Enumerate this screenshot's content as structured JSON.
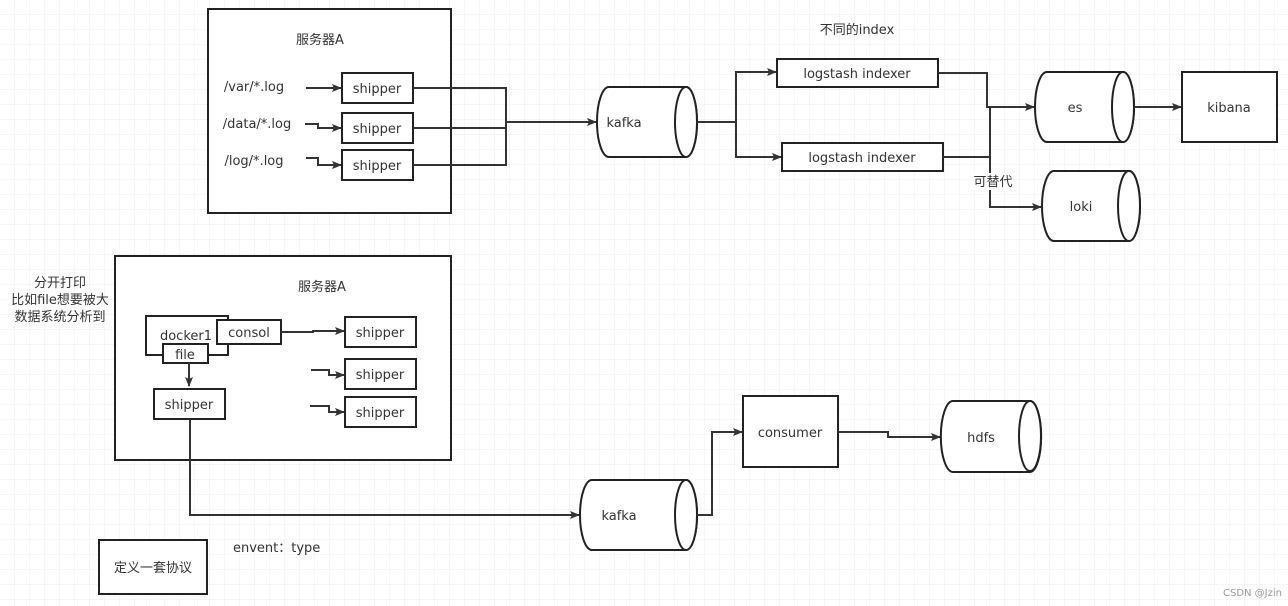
{
  "top": {
    "server_title": "服务器A",
    "log_paths": [
      "/var/*.log",
      "/data/*.log",
      "/log/*.log"
    ],
    "shippers": [
      "shipper",
      "shipper",
      "shipper"
    ],
    "kafka": "kafka",
    "index_note": "不同的index",
    "indexers": [
      "logstash indexer",
      "logstash indexer"
    ],
    "es": "es",
    "kibana": "kibana",
    "alt_label": "可替代",
    "loki": "loki"
  },
  "bottom": {
    "note_lines": [
      "分开打印",
      "比如file想要被大",
      "数据系统分析到"
    ],
    "server_title": "服务器A",
    "docker": "docker1",
    "consol": "consol",
    "file": "file",
    "shippers": [
      "shipper",
      "shipper",
      "shipper"
    ],
    "inner_shipper": "shipper",
    "kafka": "kafka",
    "consumer": "consumer",
    "hdfs": "hdfs",
    "protocol_box": "定义一套协议",
    "protocol_text": "envent：type"
  },
  "watermark": "CSDN @Jzin"
}
